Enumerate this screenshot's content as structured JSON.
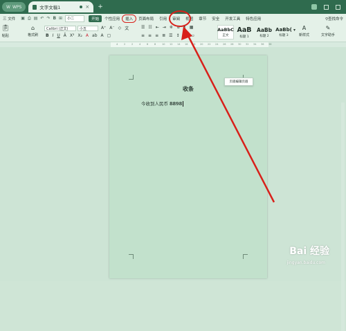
{
  "titlebar": {
    "app_tab_label": "WPS",
    "doc_tab_label": "文字文稿1",
    "doc_tab_close": "×",
    "add_tab": "+"
  },
  "menubar": {
    "file_label": "三 文件",
    "font_size_mini": "小二",
    "tabs": [
      "开始",
      "个性应用",
      "插入",
      "页面布局",
      "引用",
      "审阅",
      "视图",
      "章节",
      "安全",
      "开发工具",
      "特色应用"
    ],
    "active_tab": "开始",
    "highlighted_tab": "插入",
    "search_label": "查找命令"
  },
  "ribbon": {
    "paste_label": "粘贴",
    "format_painter_label": "格式刷",
    "font_name": "Calibri (正文)",
    "font_size": "小五",
    "styles": [
      {
        "preview": "AaBbC",
        "label": "正文"
      },
      {
        "preview": "AaB",
        "label": "标题 1"
      },
      {
        "preview": "AaBb",
        "label": "标题 2"
      },
      {
        "preview": "AaBb(",
        "label": "标题 3"
      }
    ],
    "new_style_label": "新样式",
    "writer_label": "文字助手"
  },
  "ruler": {
    "ticks": [
      "4",
      "2",
      "2",
      "4",
      "6",
      "8",
      "10",
      "12",
      "14",
      "16",
      "18",
      "20",
      "22",
      "24",
      "26",
      "28",
      "30",
      "32",
      "34",
      "36",
      "38"
    ]
  },
  "document": {
    "title": "收条",
    "body_prefix": "今收到人民币",
    "amount": "8898",
    "exit_header_footer": "页眉编辑页眉"
  },
  "watermark": {
    "brand": "Bai 经验",
    "url": "jingyan.baidu.com"
  },
  "colors": {
    "titlebar": "#2f6b4e",
    "ribbon": "#e4f1e8",
    "page": "#c2e1cc",
    "annotation": "#d8201a"
  }
}
